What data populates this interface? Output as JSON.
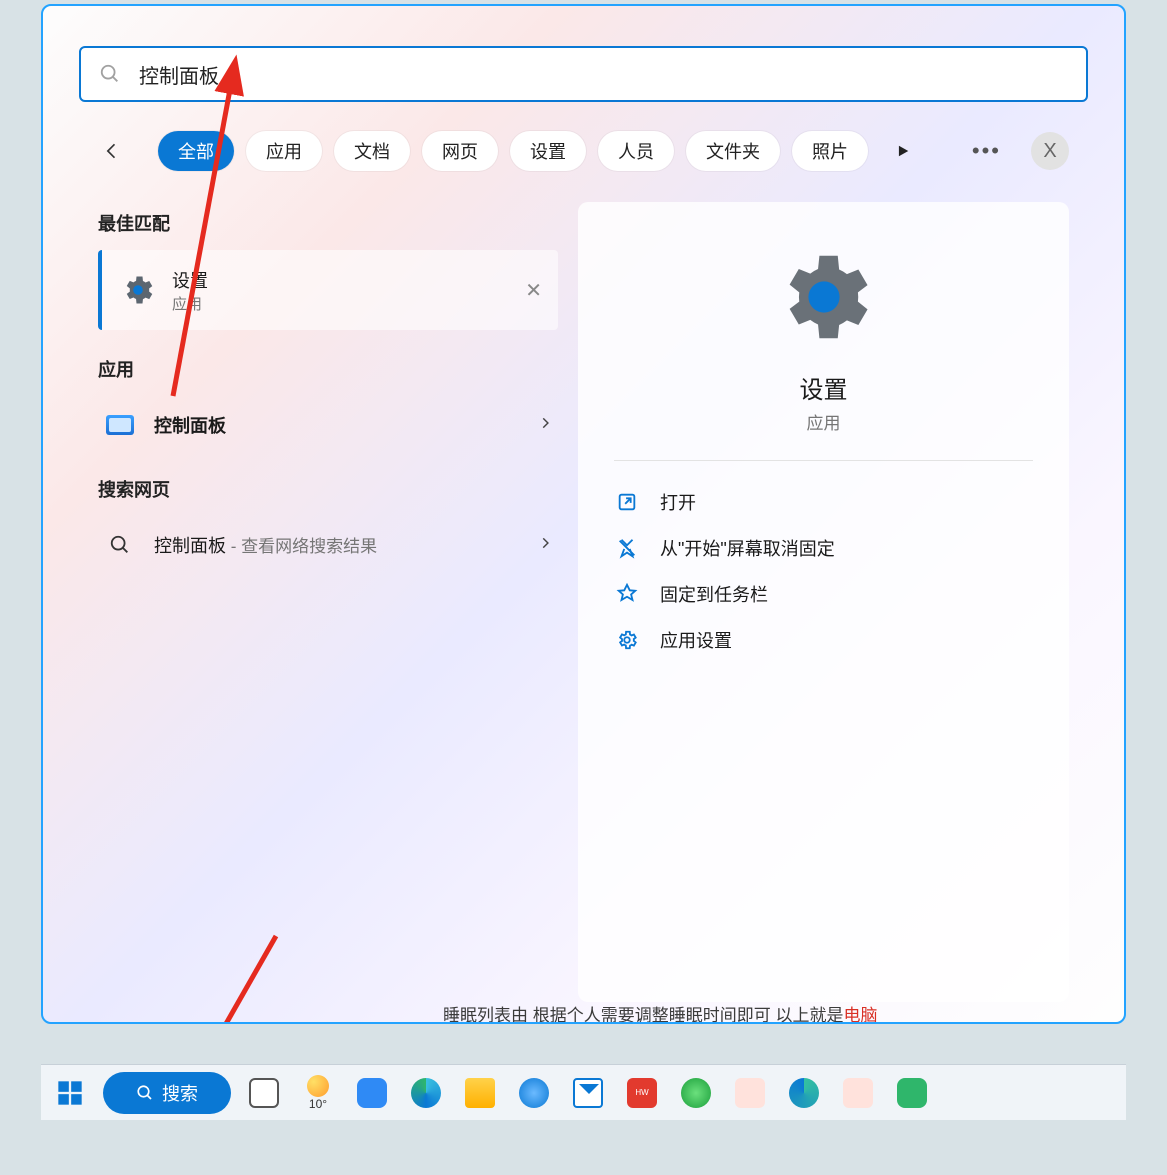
{
  "search": {
    "value": "控制面板"
  },
  "filters": {
    "items": [
      {
        "label": "全部",
        "active": true
      },
      {
        "label": "应用",
        "active": false
      },
      {
        "label": "文档",
        "active": false
      },
      {
        "label": "网页",
        "active": false
      },
      {
        "label": "设置",
        "active": false
      },
      {
        "label": "人员",
        "active": false
      },
      {
        "label": "文件夹",
        "active": false
      },
      {
        "label": "照片",
        "active": false
      }
    ],
    "avatar": "X"
  },
  "left": {
    "best_header": "最佳匹配",
    "best_match": {
      "title": "设置",
      "subtitle": "应用",
      "icon": "gear-icon"
    },
    "apps_header": "应用",
    "app_result": {
      "label": "控制面板",
      "icon": "control-panel-icon"
    },
    "web_header": "搜索网页",
    "web_result": {
      "label": "控制面板",
      "suffix": " - 查看网络搜索结果",
      "icon": "search-icon"
    }
  },
  "right": {
    "title": "设置",
    "category": "应用",
    "actions": [
      {
        "label": "打开",
        "icon": "open-icon"
      },
      {
        "label": "从\"开始\"屏幕取消固定",
        "icon": "unpin-start-icon"
      },
      {
        "label": "固定到任务栏",
        "icon": "pin-taskbar-icon"
      },
      {
        "label": "应用设置",
        "icon": "app-settings-icon"
      }
    ]
  },
  "background_text": {
    "pre": "睡眠列表由  根据个人需要调整睡眠时间即可  以上就是",
    "highlight": "电脑"
  },
  "taskbar": {
    "search_label": "搜索",
    "weather": "10°",
    "icons": [
      "task-view-icon",
      "weather-icon",
      "chat-icon",
      "edge-icon",
      "file-explorer-icon",
      "browser-icon",
      "mail-icon",
      "huawei-icon",
      "ie-icon",
      "people1-icon",
      "globe-edge-icon",
      "people2-icon",
      "wechat-icon"
    ]
  },
  "colors": {
    "accent": "#0a78d4",
    "outline": "#23a3ff"
  }
}
